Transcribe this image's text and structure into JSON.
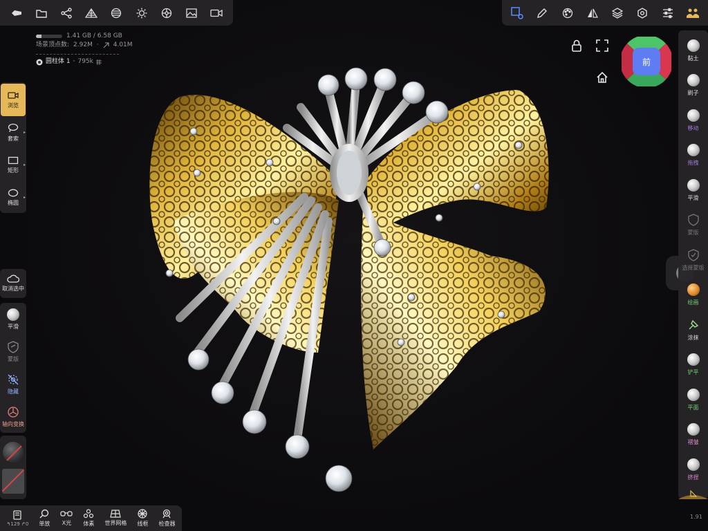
{
  "top_left_toolbar": {
    "items": [
      "back-icon",
      "folder-icon",
      "share-icon",
      "scene-icon",
      "material-icon",
      "light-icon",
      "postprocess-icon",
      "image-icon",
      "video-icon"
    ]
  },
  "top_right_toolbar": {
    "items": [
      "select-object-icon",
      "pen-icon",
      "palette-icon",
      "symmetry-icon",
      "layers-icon",
      "settings-icon",
      "sliders-icon",
      "user-icon"
    ]
  },
  "stats": {
    "memory": "1.41 GB / 6.58 GB",
    "memory_fraction": 0.214,
    "vertices_label": "场景顶点数:",
    "vertices": "2.92M",
    "faces": "4.01M",
    "mesh_name": "圆柱体 1",
    "mesh_count": "795k"
  },
  "left_tools": [
    {
      "label": "浏览",
      "icon": "camera-icon",
      "active": true
    },
    {
      "label": "套索",
      "icon": "lasso-icon",
      "active": false
    },
    {
      "label": "矩形",
      "icon": "rectangle-icon",
      "active": false
    },
    {
      "label": "椭圆",
      "icon": "ellipse-icon",
      "active": false
    }
  ],
  "deselect": {
    "label": "取消选中",
    "icon": "cloud-icon"
  },
  "brush_tools": [
    {
      "label": "平滑",
      "icon": "smooth-icon"
    },
    {
      "label": "蒙版",
      "icon": "mask-icon"
    },
    {
      "label": "隐藏",
      "icon": "hide-icon"
    },
    {
      "label": "轴向变换",
      "icon": "axis-transform-icon"
    }
  ],
  "bottom_bar": {
    "items": [
      {
        "label": "↰129 ↱0",
        "icon": "undo-icon"
      },
      {
        "label": "单放",
        "icon": "zoom-icon"
      },
      {
        "label": "X光",
        "icon": "xray-icon"
      },
      {
        "label": "体素",
        "icon": "voxel-icon"
      },
      {
        "label": "世界网格",
        "icon": "grid-icon"
      },
      {
        "label": "线框",
        "icon": "wireframe-icon"
      },
      {
        "label": "检查器",
        "icon": "inspector-icon"
      }
    ]
  },
  "right_tools": [
    {
      "label": "黏土",
      "color": "#dddddd",
      "dim": false
    },
    {
      "label": "刷子",
      "color": "#dddddd",
      "dim": false
    },
    {
      "label": "移动",
      "color": "#a77bd6",
      "dim": false
    },
    {
      "label": "拖拽",
      "color": "#a77bd6",
      "dim": false
    },
    {
      "label": "平滑",
      "color": "#dddddd",
      "dim": false
    },
    {
      "label": "蒙版",
      "color": "#777777",
      "dim": true
    },
    {
      "label": "选择蒙版",
      "color": "#777777",
      "dim": true
    },
    {
      "label": "绘画",
      "color": "#6fd36f",
      "dim": false
    },
    {
      "label": "涂抹",
      "color": "#dddddd",
      "dim": false
    },
    {
      "label": "铲平",
      "color": "#6fd36f",
      "dim": false
    },
    {
      "label": "平面",
      "color": "#6fd36f",
      "dim": false
    },
    {
      "label": "褶皱",
      "color": "#e08ad0",
      "dim": false
    },
    {
      "label": "挤捏",
      "color": "#e08ad0",
      "dim": false
    }
  ],
  "gizmo": {
    "label": "前"
  },
  "version": "1.91"
}
